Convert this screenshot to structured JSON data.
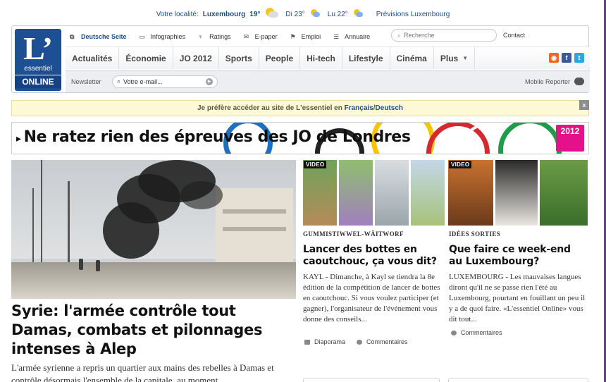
{
  "weather": {
    "locality_label": "Votre localité:",
    "city": "Luxembourg",
    "temp_now": "19°",
    "day1": "Di 23°",
    "day2": "Lu 22°",
    "forecast_link": "Prévisions Luxembourg"
  },
  "logo": {
    "letter": "L’",
    "word1": "essentiel",
    "word2": "ONLINE"
  },
  "util_links": [
    {
      "label": "Deutsche Seite",
      "icon": "external-link-icon"
    },
    {
      "label": "Infographies",
      "icon": "monitor-icon"
    },
    {
      "label": "Ratings",
      "icon": "trophy-icon"
    },
    {
      "label": "E-paper",
      "icon": "envelope-icon"
    },
    {
      "label": "Emploi",
      "icon": "flag-icon"
    },
    {
      "label": "Annuaire",
      "icon": "list-icon"
    }
  ],
  "search": {
    "placeholder": "Recherche"
  },
  "contact": "Contact",
  "nav": [
    "Actualités",
    "Économie",
    "JO 2012",
    "Sports",
    "People",
    "Hi-tech",
    "Lifestyle",
    "Cinéma",
    "Plus"
  ],
  "social": [
    {
      "name": "rss-icon",
      "glyph": "◉",
      "color": "#f26522"
    },
    {
      "name": "facebook-icon",
      "glyph": "f",
      "color": "#3b5998"
    },
    {
      "name": "twitter-icon",
      "glyph": "t",
      "color": "#29a9e1"
    }
  ],
  "newsletter": {
    "label": "Newsletter",
    "placeholder": "Votre e-mail...",
    "value": "Votre e-mail..."
  },
  "mobile_reporter": "Mobile Reporter",
  "lang_bar": {
    "prefix": "Je préfère accéder au site de L'essentiel en",
    "fr": "Français",
    "sep": " / ",
    "de": "Deutsch",
    "close": "x"
  },
  "banner": {
    "text": "Ne ratez rien des épreuves des JO de Londres",
    "logo_text": "2012"
  },
  "main_story": {
    "headline": "Syrie: l'armée contrôle tout Damas, combats et pilonnages intenses à Alep",
    "lede": "L'armée syrienne a repris un quartier aux mains des rebelles à Damas et contrôle désormais l'ensemble de la capitale, au moment"
  },
  "story2": {
    "video_label": "VIDEO",
    "kicker": "GUMMISTIWWEL-WÄITWORF",
    "headline": "Lancer des bottes en caoutchouc, ça vous dit?",
    "lede": "KAYL - Dimanche, à Kayl se tiendra la 8e édition de la compétition de lancer de bottes en caoutchouc. Si vous voulez participer (et gagner), l'organisateur de l'événement vous donne des conseils...",
    "meta1": "Diaporama",
    "meta2": "Commentaires"
  },
  "story3": {
    "video_label": "VIDEO",
    "kicker": "IDÉES SORTIES",
    "headline": "Que faire ce week-end au Luxembourg?",
    "lede": "LUXEMBOURG - Les mauvaises langues diront qu'il ne se passe rien l'été au Luxembourg, pourtant en fouillant un peu il y a de quoi faire. «L'essentiel Online» vous dit tout...",
    "meta1": "Commentaires"
  },
  "colors": {
    "brand_blue": "#1d4f94",
    "link_blue": "#1a4d8c",
    "lang_bg": "#fdf9d6",
    "london_pink": "#e4128a"
  }
}
